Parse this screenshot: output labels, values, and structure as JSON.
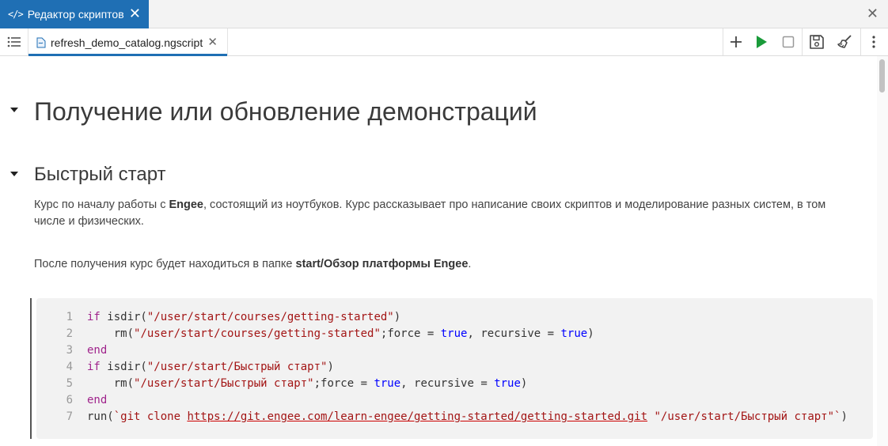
{
  "panel": {
    "tab_label": "Редактор скриптов",
    "tab_icon": "code-icon",
    "close_glyph": "✕",
    "panel_close_glyph": "✕"
  },
  "editor": {
    "file_tab": "refresh_demo_catalog.ngscript",
    "file_close_glyph": "✕",
    "toolbar": [
      "outline-list-icon",
      "add-icon",
      "run-icon",
      "stop-icon",
      "save-icon",
      "clear-output-icon",
      "more-icon"
    ],
    "accent_color": "#1f6fb4",
    "run_color": "#1a9b3a"
  },
  "document": {
    "heading1": "Получение или обновление демонстраций",
    "heading2": "Быстрый старт",
    "para1_prefix": "Курс по началу работы с ",
    "para1_bold": "Engee",
    "para1_suffix": ", состоящий из ноутбуков. Курс рассказывает про написание своих скриптов и моделирование разных систем, в том числе и физических.",
    "para2_prefix": "После получения курс будет находиться в папке ",
    "para2_bold": "start/Обзор платформы Engee",
    "para2_suffix": "."
  },
  "code": {
    "line_numbers": [
      "1",
      "2",
      "3",
      "4",
      "5",
      "6",
      "7"
    ],
    "l1_kw": "if",
    "l1_fn": " isdir(",
    "l1_str": "\"/user/start/courses/getting-started\"",
    "l1_end": ")",
    "l2_fn": "    rm(",
    "l2_str": "\"/user/start/courses/getting-started\"",
    "l2_mid": ";force = ",
    "l2_b1": "true",
    "l2_mid2": ", recursive = ",
    "l2_b2": "true",
    "l2_end": ")",
    "l3_kw": "end",
    "l4_kw": "if",
    "l4_fn": " isdir(",
    "l4_str": "\"/user/start/Быстрый старт\"",
    "l4_end": ")",
    "l5_fn": "    rm(",
    "l5_str": "\"/user/start/Быстрый старт\"",
    "l5_mid": ";force = ",
    "l5_b1": "true",
    "l5_mid2": ", recursive = ",
    "l5_b2": "true",
    "l5_end": ")",
    "l6_kw": "end",
    "l7_fn": "run(",
    "l7_cmd": "`git clone ",
    "l7_url": "https://git.engee.com/learn-engee/getting-started/getting-started.git",
    "l7_str": " \"/user/start/Быстрый старт\"`",
    "l7_end": ")"
  }
}
